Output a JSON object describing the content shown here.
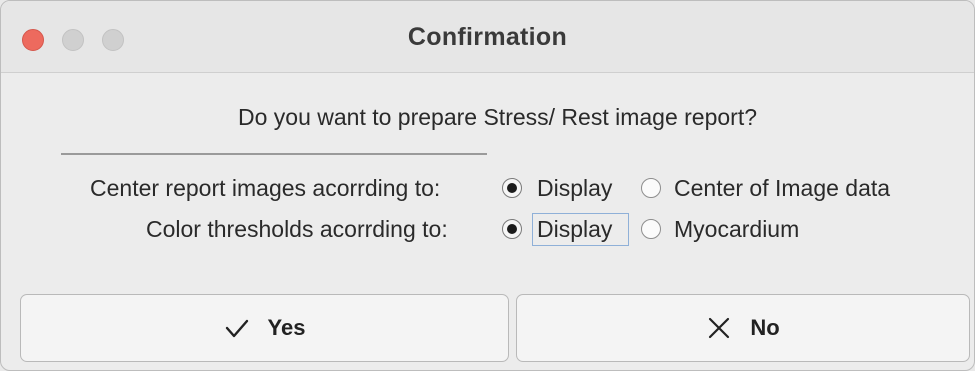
{
  "window": {
    "title": "Confirmation"
  },
  "dialog": {
    "question": "Do you want to prepare Stress/ Rest image report?",
    "center_row": {
      "label": "Center report images acorrding to:",
      "options": [
        {
          "label": "Display",
          "selected": true
        },
        {
          "label": "Center of Image data",
          "selected": false
        }
      ]
    },
    "color_row": {
      "label": "Color thresholds acorrding to:",
      "options": [
        {
          "label": "Display",
          "selected": true,
          "focused": true
        },
        {
          "label": "Myocardium",
          "selected": false
        }
      ]
    }
  },
  "buttons": {
    "yes": {
      "label": "Yes",
      "icon": "checkmark-icon"
    },
    "no": {
      "label": "No",
      "icon": "x-icon"
    }
  }
}
